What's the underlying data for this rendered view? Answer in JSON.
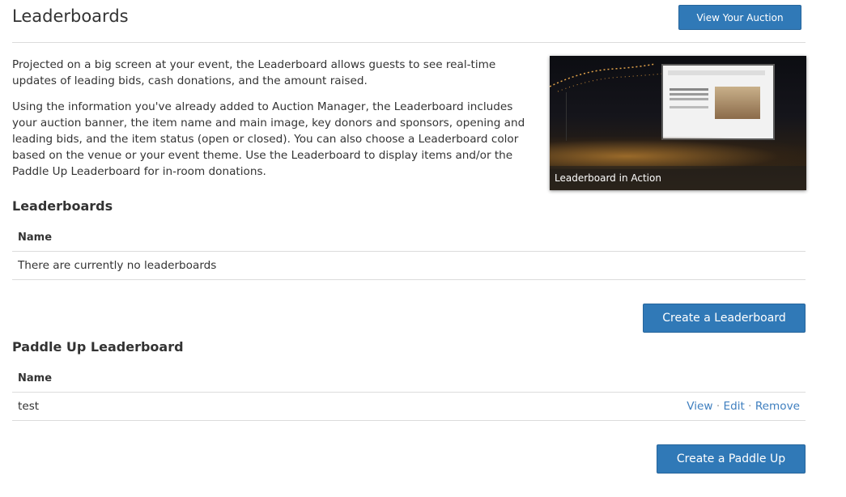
{
  "header": {
    "title": "Leaderboards",
    "view_auction_label": "View Your Auction"
  },
  "intro": {
    "paragraph_1": "Projected on a big screen at your event, the Leaderboard allows guests to see real-time updates of leading bids, cash donations, and the amount raised.",
    "paragraph_2": "Using the information you've already added to Auction Manager, the Leaderboard includes your auction banner, the item name and main image, key donors and sponsors, opening and leading bids, and the item status (open or closed). You can also choose a Leaderboard color based on the venue or your event theme. Use the Leaderboard to display items and/or the Paddle Up Leaderboard for in-room donations."
  },
  "hero": {
    "caption": "Leaderboard in Action"
  },
  "leaderboards": {
    "heading": "Leaderboards",
    "column_name": "Name",
    "empty_message": "There are currently no leaderboards",
    "create_label": "Create a Leaderboard"
  },
  "paddle_up": {
    "heading": "Paddle Up Leaderboard",
    "column_name": "Name",
    "rows": [
      {
        "name": "test",
        "view_label": "View",
        "edit_label": "Edit",
        "remove_label": "Remove",
        "separator": "·"
      }
    ],
    "create_label": "Create a Paddle Up"
  }
}
